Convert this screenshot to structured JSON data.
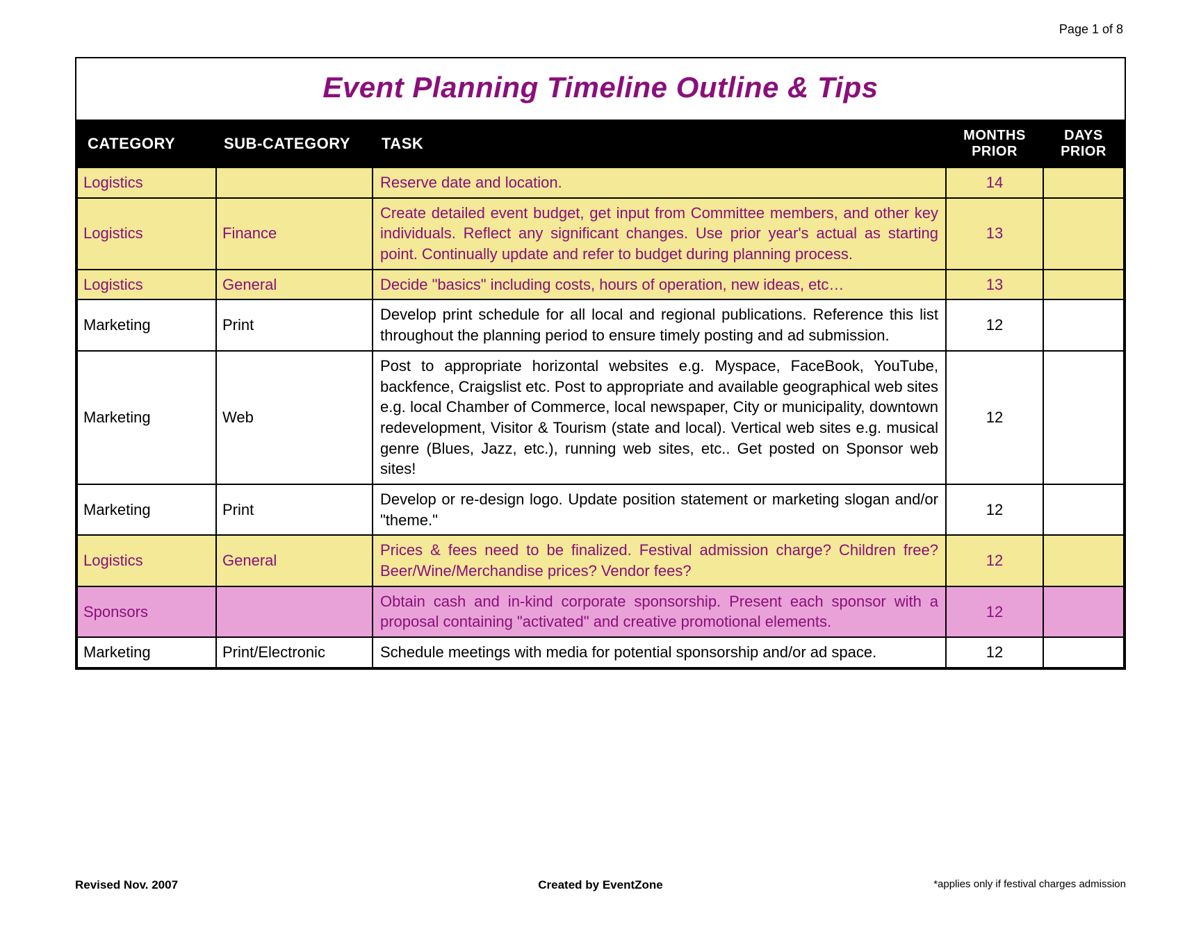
{
  "page_indicator": "Page 1 of 8",
  "title": "Event Planning Timeline Outline & Tips",
  "headers": {
    "category": "CATEGORY",
    "subcategory": "SUB-CATEGORY",
    "task": "TASK",
    "months": "MONTHS PRIOR",
    "days": "DAYS PRIOR"
  },
  "rows": [
    {
      "style": "yellow",
      "category": "Logistics",
      "subcategory": "",
      "task": "Reserve date and location.",
      "months": "14",
      "days": ""
    },
    {
      "style": "yellow",
      "category": "Logistics",
      "subcategory": "Finance",
      "task": "Create detailed event budget, get input from Committee members, and other key individuals. Reflect any significant changes. Use prior year's actual as starting point. Continually update and refer to budget during planning process.",
      "months": "13",
      "days": ""
    },
    {
      "style": "yellow",
      "category": "Logistics",
      "subcategory": "General",
      "task": "Decide \"basics\" including costs, hours of operation, new ideas, etc…",
      "months": "13",
      "days": ""
    },
    {
      "style": "white",
      "category": "Marketing",
      "subcategory": "Print",
      "task": "Develop print schedule for all local and regional publications. Reference this list throughout the planning period to ensure timely posting and ad submission.",
      "months": "12",
      "days": ""
    },
    {
      "style": "white",
      "category": "Marketing",
      "subcategory": "Web",
      "task": "Post to appropriate horizontal websites e.g. Myspace, FaceBook, YouTube, backfence, Craigslist etc. Post to appropriate and available geographical web sites e.g. local Chamber of Commerce, local newspaper, City or municipality, downtown redevelopment, Visitor & Tourism (state and local). Vertical web sites e.g. musical genre (Blues, Jazz, etc.), running web sites, etc.. Get posted on Sponsor web sites!",
      "months": "12",
      "days": ""
    },
    {
      "style": "white",
      "category": "Marketing",
      "subcategory": "Print",
      "task": "Develop or re-design logo. Update position statement or marketing slogan and/or \"theme.\"",
      "months": "12",
      "days": ""
    },
    {
      "style": "yellow",
      "category": "Logistics",
      "subcategory": "General",
      "task": "Prices & fees need to be finalized. Festival admission charge? Children free?  Beer/Wine/Merchandise prices? Vendor fees?",
      "months": "12",
      "days": ""
    },
    {
      "style": "pink",
      "category": "Sponsors",
      "subcategory": "",
      "task": "Obtain cash and in-kind corporate sponsorship. Present each sponsor with a proposal containing \"activated\" and creative promotional elements.",
      "months": "12",
      "days": ""
    },
    {
      "style": "white",
      "category": "Marketing",
      "subcategory": "Print/Electronic",
      "task": "Schedule meetings with media for potential sponsorship and/or ad space.",
      "months": "12",
      "days": ""
    }
  ],
  "footer": {
    "left": "Revised Nov. 2007",
    "center": "Created by EventZone",
    "right": "*applies only if festival charges admission"
  }
}
